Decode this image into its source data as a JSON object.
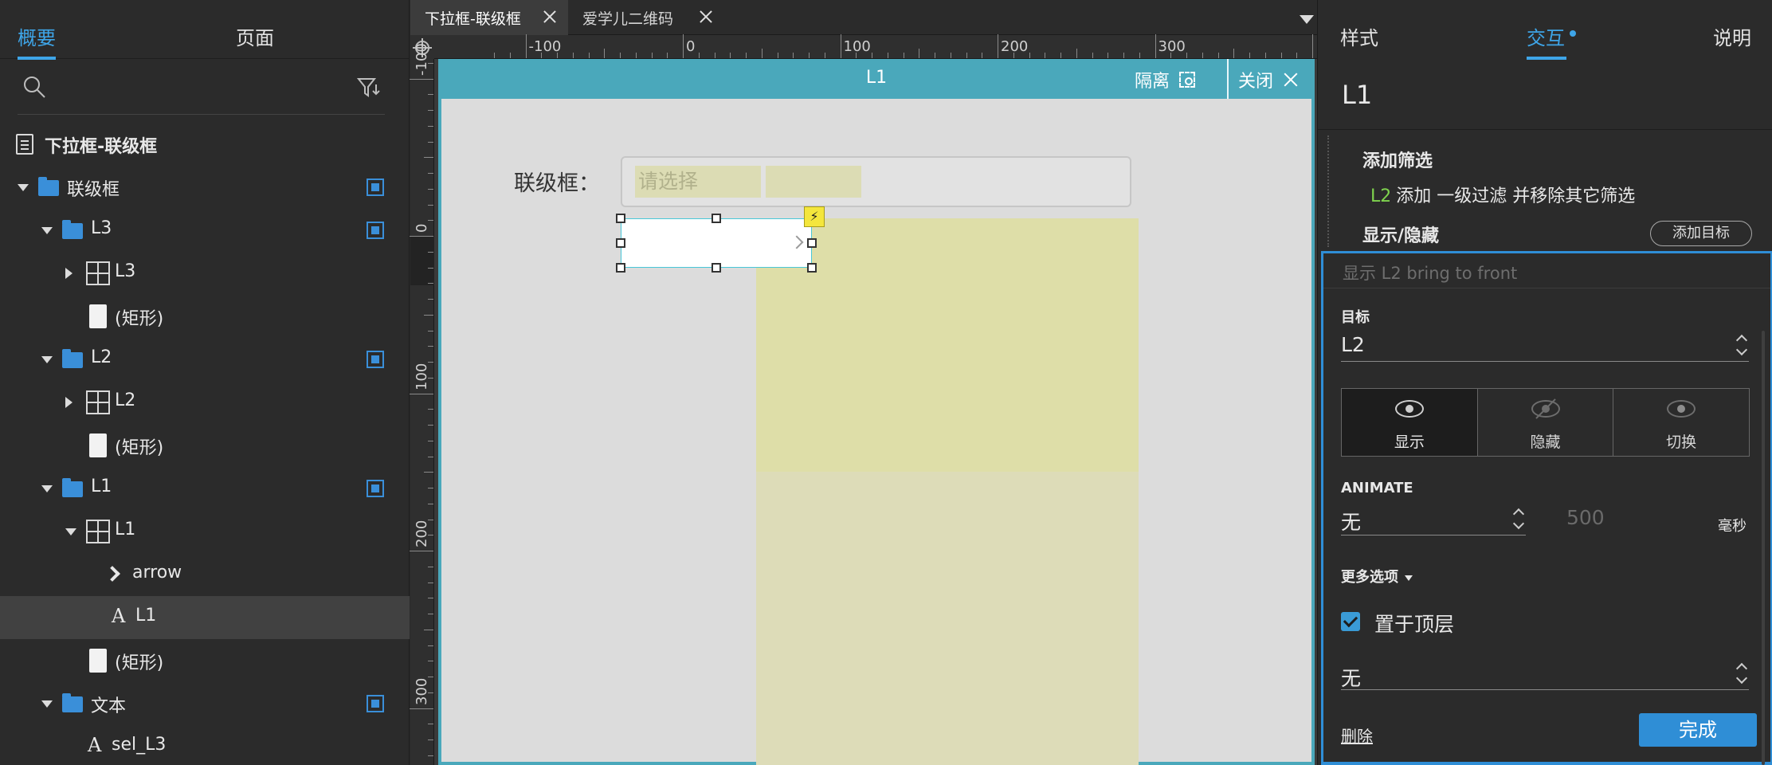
{
  "left_panel": {
    "tabs": {
      "overview": "概要",
      "pages": "页面"
    },
    "tree": [
      {
        "label": "下拉框-联级框",
        "type": "page",
        "indent": 0,
        "twisty": "none",
        "vis": false
      },
      {
        "label": "联级框",
        "type": "folder",
        "indent": 0,
        "twisty": "down",
        "vis": true
      },
      {
        "label": "L3",
        "type": "folder",
        "indent": 1,
        "twisty": "down",
        "vis": true
      },
      {
        "label": "L3",
        "type": "repeater",
        "indent": 2,
        "twisty": "right",
        "vis": false
      },
      {
        "label": "(矩形)",
        "type": "rect",
        "indent": 2,
        "twisty": "none",
        "vis": false
      },
      {
        "label": "L2",
        "type": "folder",
        "indent": 1,
        "twisty": "down",
        "vis": true
      },
      {
        "label": "L2",
        "type": "repeater",
        "indent": 2,
        "twisty": "right",
        "vis": false
      },
      {
        "label": "(矩形)",
        "type": "rect",
        "indent": 2,
        "twisty": "none",
        "vis": false
      },
      {
        "label": "L1",
        "type": "folder",
        "indent": 1,
        "twisty": "down",
        "vis": true
      },
      {
        "label": "L1",
        "type": "repeater",
        "indent": 2,
        "twisty": "down",
        "vis": false
      },
      {
        "label": "arrow",
        "type": "arrow",
        "indent": 3,
        "twisty": "none",
        "vis": false
      },
      {
        "label": "L1",
        "type": "text",
        "indent": 3,
        "twisty": "none",
        "vis": false,
        "selected": true
      },
      {
        "label": "(矩形)",
        "type": "rect",
        "indent": 2,
        "twisty": "none",
        "vis": false
      },
      {
        "label": "文本",
        "type": "folder",
        "indent": 1,
        "twisty": "down",
        "vis": true
      },
      {
        "label": "sel_L3",
        "type": "text",
        "indent": 2,
        "twisty": "none",
        "vis": false
      }
    ]
  },
  "doc_tabs": [
    {
      "label": "下拉框-联级框",
      "active": true
    },
    {
      "label": "爱学儿二维码",
      "active": false
    }
  ],
  "ruler": {
    "h_labels": [
      "-100",
      "0",
      "100",
      "200",
      "300"
    ],
    "v_labels": [
      "-100",
      "0",
      "100",
      "200",
      "300"
    ]
  },
  "isolate_bar": {
    "title": "L1",
    "isolate": "隔离",
    "close": "关闭"
  },
  "canvas": {
    "label": "联级框：",
    "combo_placeholder": "请选择"
  },
  "right_panel": {
    "tabs": {
      "style": "样式",
      "interact": "交互",
      "notes": "说明"
    },
    "widget_name": "L1",
    "filter_section": "添加筛选",
    "filter_target": "L2",
    "filter_text": "添加 一级过滤 并移除其它筛选",
    "showhide_section": "显示/隐藏",
    "add_target": "添加目标",
    "editor": {
      "summary": "显示 L2  bring to front",
      "target_label": "目标",
      "target_value": "L2",
      "segments": [
        "显示",
        "隐藏",
        "切换"
      ],
      "animate_label": "ANIMATE",
      "animate_value": "无",
      "duration": "500",
      "duration_unit": "毫秒",
      "more_options": "更多选项",
      "bring_front": "置于顶层",
      "layer_value": "无",
      "delete": "删除",
      "done": "完成"
    }
  },
  "colors": {
    "accent": "#3ea5e8",
    "isolate": "#4aa8bb",
    "folder": "#3a8fd9",
    "highlight_green": "#7fd34e"
  }
}
